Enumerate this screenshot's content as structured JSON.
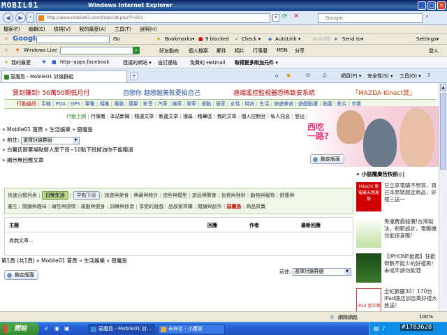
{
  "window": {
    "brand": "MOBIL01",
    "title": "Windows Internet Explorer",
    "minimize": "_",
    "maximize": "□",
    "close": "×"
  },
  "address": {
    "url": "http://www.mobile01.com/topiclist.php?f=601",
    "search_placeholder": "Google"
  },
  "menu": [
    "檔案(F)",
    "編輯(E)",
    "檢視(V)",
    "我的最愛(A)",
    "工具(T)",
    "說明(H)"
  ],
  "google_bar": {
    "logo": "Google",
    "go": "Go",
    "bookmarks": "Bookmarks▾",
    "blocked": "9 blocked",
    "check": "Check ▾",
    "autolink": "AutoLink ▾",
    "autofill": "AutoFill",
    "send_to": "Send to▾",
    "settings": "Settings▾"
  },
  "live_bar": {
    "brand": "Windows Live",
    "links": [
      "好友動向",
      "個人檔案",
      "郵件",
      "相片",
      "行事曆",
      "MSN",
      "分享"
    ],
    "signin": "登入"
  },
  "favorites_bar": {
    "label": "我的最愛",
    "items": [
      "http--apps.facebook",
      "建議的網站 ▾",
      "自訂連結",
      "免費的 Hotmail",
      "取得更多附加元件 ▾"
    ]
  },
  "tab": {
    "label": "惡魔島 - Mobile01 討論群組"
  },
  "tab_tools": {
    "page": "網頁(P) ▾",
    "safety": "安全性(S) ▾",
    "tools": "工具(O) ▾",
    "help": "?"
  },
  "promos": [
    {
      "text": "買到賺到! 50萬50期低月付",
      "color": "#c00000"
    },
    {
      "text": "自戀你 越戀越美就愛拍自己",
      "color": "#1f4fa0"
    },
    {
      "text": "遠端遙控監視器恐怖致安系統",
      "color": "#c00000"
    },
    {
      "text": "「MAZDA Kinect賞」",
      "color": "#c04000"
    }
  ],
  "main_nav": [
    "行動通訊",
    "手機",
    "PDA",
    "GPS",
    "筆電",
    "相機",
    "電腦",
    "蘋果",
    "影音",
    "汽車",
    "機車",
    "單車",
    "運動",
    "居家",
    "女性",
    "時尚",
    "生活",
    "旅遊美食",
    "遊戲動漫",
    "貼圖",
    "影片",
    "市集"
  ],
  "sub_nav": [
    "行動上網",
    "行事曆",
    "本站新聞",
    "精選文章",
    "新進文章",
    "搜尋",
    "精華區",
    "我的文章",
    "個人控制台",
    "私人訊息",
    "登出",
    "[帳號蹤跡]"
  ],
  "breadcrumb": "» Mobile01 首頁 » 生活娛樂 » 惡魔島",
  "jump": {
    "label": "» 前往:",
    "value": "選擇討論群組"
  },
  "notes": [
    "» 白鷺氏廢棄場點廢人愛下班~10點下班掉油你不能贈過",
    "» 顯示無回應文章"
  ],
  "banner": {
    "headline": "西吃\n一路?"
  },
  "buttons": {
    "new_topic": "鎖定版面",
    "new_topic2": "鎖定版面"
  },
  "category_bar": {
    "row1": [
      "快速分類列表",
      "日常生活",
      "早點下班",
      "旅遊與美食",
      "典藏與時計",
      "造型與模型",
      "遊品博覽會",
      "投資與理財",
      "動物與寵物",
      "健康與"
    ],
    "row2": [
      "養生",
      "閱讀與趣味",
      "兩性與感情",
      "運動與健身",
      "訓練與修習",
      "享受的遊戲",
      "品部家齊購",
      "閱讀與創作",
      "惡魔島",
      "商品買賣"
    ],
    "chip_green": "日常生活",
    "chip_blue": "早點下班",
    "hot_item": "惡魔島"
  },
  "table": {
    "columns": [
      "主題",
      "回應",
      "作者",
      "最新回應"
    ],
    "empty": "尚無文章..."
  },
  "pager": "第1頁 (共1頁) » Mobile01 首頁 » 生活娛樂 » 惡魔島",
  "bottom_jump": {
    "label": "前往:",
    "value": "選擇討論群組"
  },
  "sidebar": {
    "heading": "» 小惡魔廣告快訊◎|",
    "items": [
      {
        "title": "日立家電購不想買，買日本原裝服定商品，好禮三送一",
        "badge": "Hitachi 家電歲末感謝祭",
        "badge_color": "#d00000"
      },
      {
        "title": "免運費最殺價!台灣製法，創新設計，電暖機也能很身暖!",
        "badge": "",
        "badge_color": "#40a040"
      },
      {
        "title": "【IPHONE推薦】狂歡倒數不能少的好禮再! 未成年請勿飲酒",
        "badge": "",
        "badge_color": "#1a4a1a"
      },
      {
        "title": "全虹歡慶30！170台iPad盛店加百萬好禮大放送！",
        "badge": "iPad 盛店購",
        "badge_color": "#d04040"
      }
    ]
  },
  "status": {
    "zone": "網際網路",
    "zoom": "100%"
  },
  "taskbar": {
    "start": "開始",
    "tasks": [
      "惡魔島 - Mobile01 討...",
      "未命名 - 小畫家"
    ],
    "clock": ""
  },
  "watermark": "#1783628"
}
